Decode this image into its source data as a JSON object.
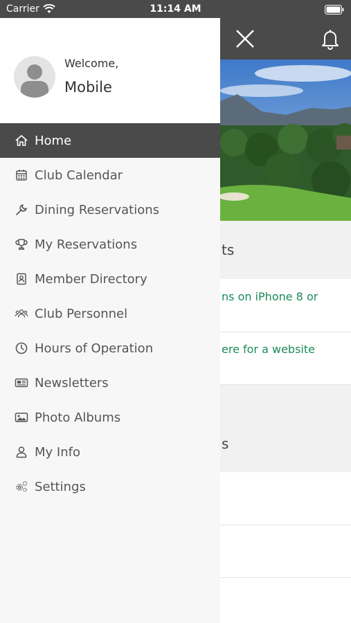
{
  "status_bar": {
    "carrier": "Carrier",
    "time": "11:14 AM"
  },
  "background": {
    "section1_title": "ts",
    "links": [
      "ns on iPhone 8 or",
      "ere for a website"
    ],
    "section2_title": "s"
  },
  "drawer": {
    "welcome": "Welcome,",
    "username": "Mobile",
    "items": [
      {
        "label": "Home",
        "icon": "home-icon",
        "active": true
      },
      {
        "label": "Club Calendar",
        "icon": "calendar-icon"
      },
      {
        "label": "Dining Reservations",
        "icon": "wrench-icon"
      },
      {
        "label": "My Reservations",
        "icon": "trophy-icon"
      },
      {
        "label": "Member Directory",
        "icon": "contact-book-icon"
      },
      {
        "label": "Club Personnel",
        "icon": "people-icon"
      },
      {
        "label": "Hours of Operation",
        "icon": "clock-icon"
      },
      {
        "label": "Newsletters",
        "icon": "newspaper-icon"
      },
      {
        "label": "Photo Albums",
        "icon": "image-icon"
      },
      {
        "label": "My Info",
        "icon": "user-icon"
      },
      {
        "label": "Settings",
        "icon": "gears-icon"
      }
    ]
  },
  "colors": {
    "header": "#4a4a4a",
    "link_green": "#1b8a5a",
    "drawer_bg": "#f7f7f7"
  }
}
